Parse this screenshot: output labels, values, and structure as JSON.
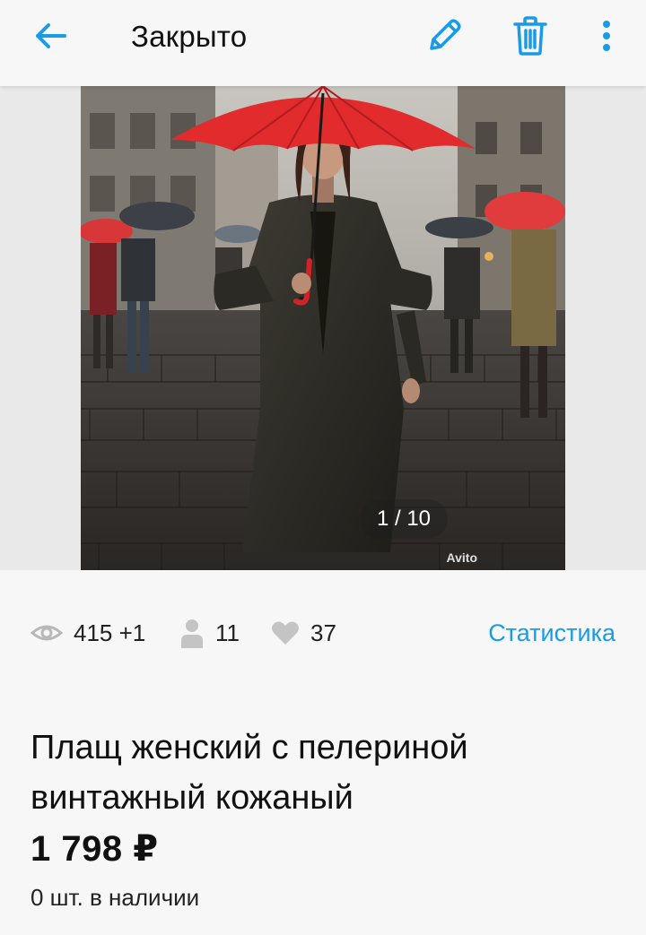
{
  "header": {
    "title": "Закрыто",
    "icons": {
      "back": "arrow-left-icon",
      "edit": "pencil-icon",
      "delete": "trash-icon",
      "more": "more-vertical-icon"
    }
  },
  "gallery": {
    "counter": "1 / 10",
    "watermark": "Avito",
    "photo_subject": "woman in long dark leather coat holding red umbrella on rainy street"
  },
  "stats": {
    "views": "415 +1",
    "contacts": "11",
    "favorites": "37",
    "link_label": "Статистика"
  },
  "product": {
    "title": "Плащ женский с пелериной винтажный кожаный",
    "price": "1 798 ₽",
    "stock": "0 шт. в наличии"
  },
  "colors": {
    "accent": "#1a9be6",
    "background": "#f7f7f7",
    "text": "#111111"
  }
}
